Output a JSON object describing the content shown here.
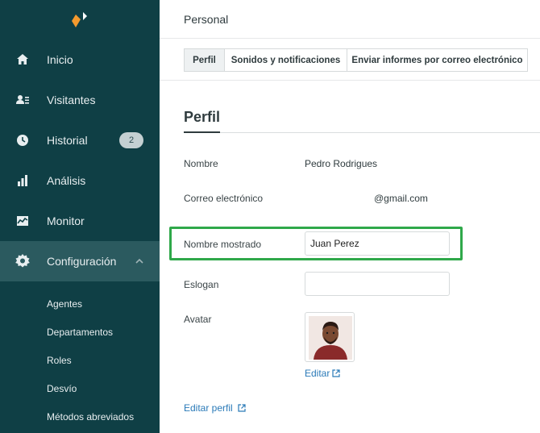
{
  "sidebar": {
    "items": [
      {
        "label": "Inicio",
        "icon": "home-icon"
      },
      {
        "label": "Visitantes",
        "icon": "visitors-icon"
      },
      {
        "label": "Historial",
        "icon": "clock-icon",
        "badge": "2"
      },
      {
        "label": "Análisis",
        "icon": "bar-chart-icon"
      },
      {
        "label": "Monitor",
        "icon": "monitor-icon"
      },
      {
        "label": "Configuración",
        "icon": "gear-icon",
        "active": true
      }
    ],
    "subitems": [
      "Agentes",
      "Departamentos",
      "Roles",
      "Desvío",
      "Métodos abreviados"
    ]
  },
  "header": {
    "title": "Personal"
  },
  "tabs": [
    {
      "label": "Perfil",
      "active": true
    },
    {
      "label": "Sonidos y notificaciones"
    },
    {
      "label": "Enviar informes por correo electrónico"
    }
  ],
  "profile": {
    "section_title": "Perfil",
    "name_label": "Nombre",
    "name_value": "Pedro Rodrigues",
    "email_label": "Correo electrónico",
    "email_value": "@gmail.com",
    "display_name_label": "Nombre mostrado",
    "display_name_value": "Juan Perez",
    "slogan_label": "Eslogan",
    "slogan_value": "",
    "avatar_label": "Avatar",
    "avatar_edit_label": "Editar",
    "edit_profile_label": "Editar perfil"
  },
  "colors": {
    "sidebar_bg": "#0f3f45",
    "sidebar_active": "#2b5a5f",
    "highlight": "#2fa84a",
    "link": "#2a7ab8",
    "logo_orange": "#f39a2e"
  }
}
